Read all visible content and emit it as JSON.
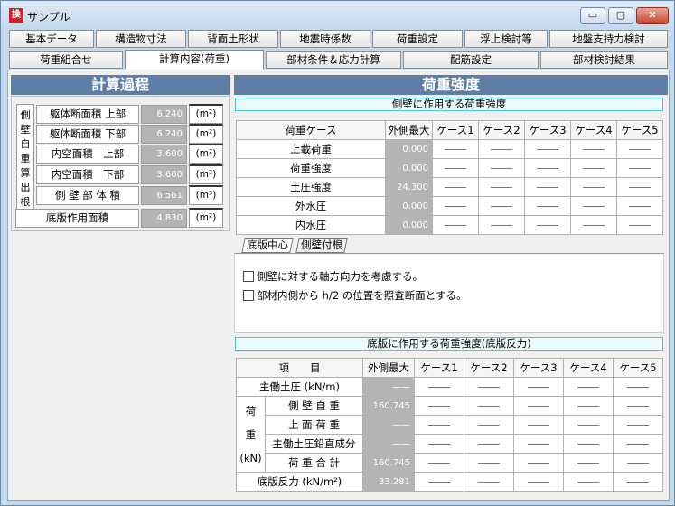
{
  "window": {
    "title": "サンプル",
    "icon": "app-icon",
    "min": "▭",
    "max": "▢",
    "close": "✕"
  },
  "tabs_row1": [
    "基本データ",
    "構造物寸法",
    "背面土形状",
    "地震時係数",
    "荷重設定",
    "浮上検討等",
    "地盤支持力検討"
  ],
  "tabs_row2": [
    "荷重組合せ",
    "計算内容(荷重)",
    "部材条件＆応力計算",
    "配筋設定",
    "部材検討結果"
  ],
  "left": {
    "title": "計算過程",
    "group_label": "側壁自重算出根拠",
    "rows": [
      {
        "label": "躯体断面積 上部",
        "value": "6.240",
        "unit": "(m²)"
      },
      {
        "label": "躯体断面積 下部",
        "value": "6.240",
        "unit": "(m²)"
      },
      {
        "label": "内空面積　上部",
        "value": "3.600",
        "unit": "(m²)"
      },
      {
        "label": "内空面積　下部",
        "value": "3.600",
        "unit": "(m²)"
      },
      {
        "label": "側 壁 部 体 積",
        "value": "6.561",
        "unit": "(m³)"
      }
    ],
    "bottom": {
      "label": "底版作用面積",
      "value": "4.830",
      "unit": "(m²)"
    }
  },
  "right": {
    "title": "荷重強度",
    "top_bar": "側壁に作用する荷重強度",
    "t1_headers": [
      "荷重ケース",
      "外側最大",
      "ケース1",
      "ケース2",
      "ケース3",
      "ケース4",
      "ケース5"
    ],
    "t1_rows": [
      {
        "label": "上載荷重",
        "value": "0.000"
      },
      {
        "label": "荷重強度",
        "value": "0.000"
      },
      {
        "label": "土圧強度",
        "value": "24.300"
      },
      {
        "label": "外水圧",
        "value": "0.000"
      },
      {
        "label": "内水圧",
        "value": "0.000"
      }
    ],
    "subtabs": [
      "底版中心",
      "側壁付根"
    ],
    "checks": [
      "側壁に対する軸方向力を考慮する。",
      "部材内側から h/2 の位置を照査断面とする。"
    ],
    "bottom_bar": "底版に作用する荷重強度(底版反力)",
    "t2_headers": [
      "項　　目",
      "外側最大",
      "ケース1",
      "ケース2",
      "ケース3",
      "ケース4",
      "ケース5"
    ],
    "t2_top": {
      "label": "主働土圧 (kN/m)",
      "value": "——"
    },
    "t2_group": [
      "荷",
      "重",
      "(kN)"
    ],
    "t2_rows": [
      {
        "label": "側 壁 自 重",
        "value": "160.745"
      },
      {
        "label": "上 面 荷 重",
        "value": "——"
      },
      {
        "label": "主働土圧鉛直成分",
        "value": "——"
      },
      {
        "label": "荷 重 合 計",
        "value": "160.745"
      }
    ],
    "t2_bottom": {
      "label": "底版反力 (kN/m²)",
      "value": "33.281"
    }
  }
}
